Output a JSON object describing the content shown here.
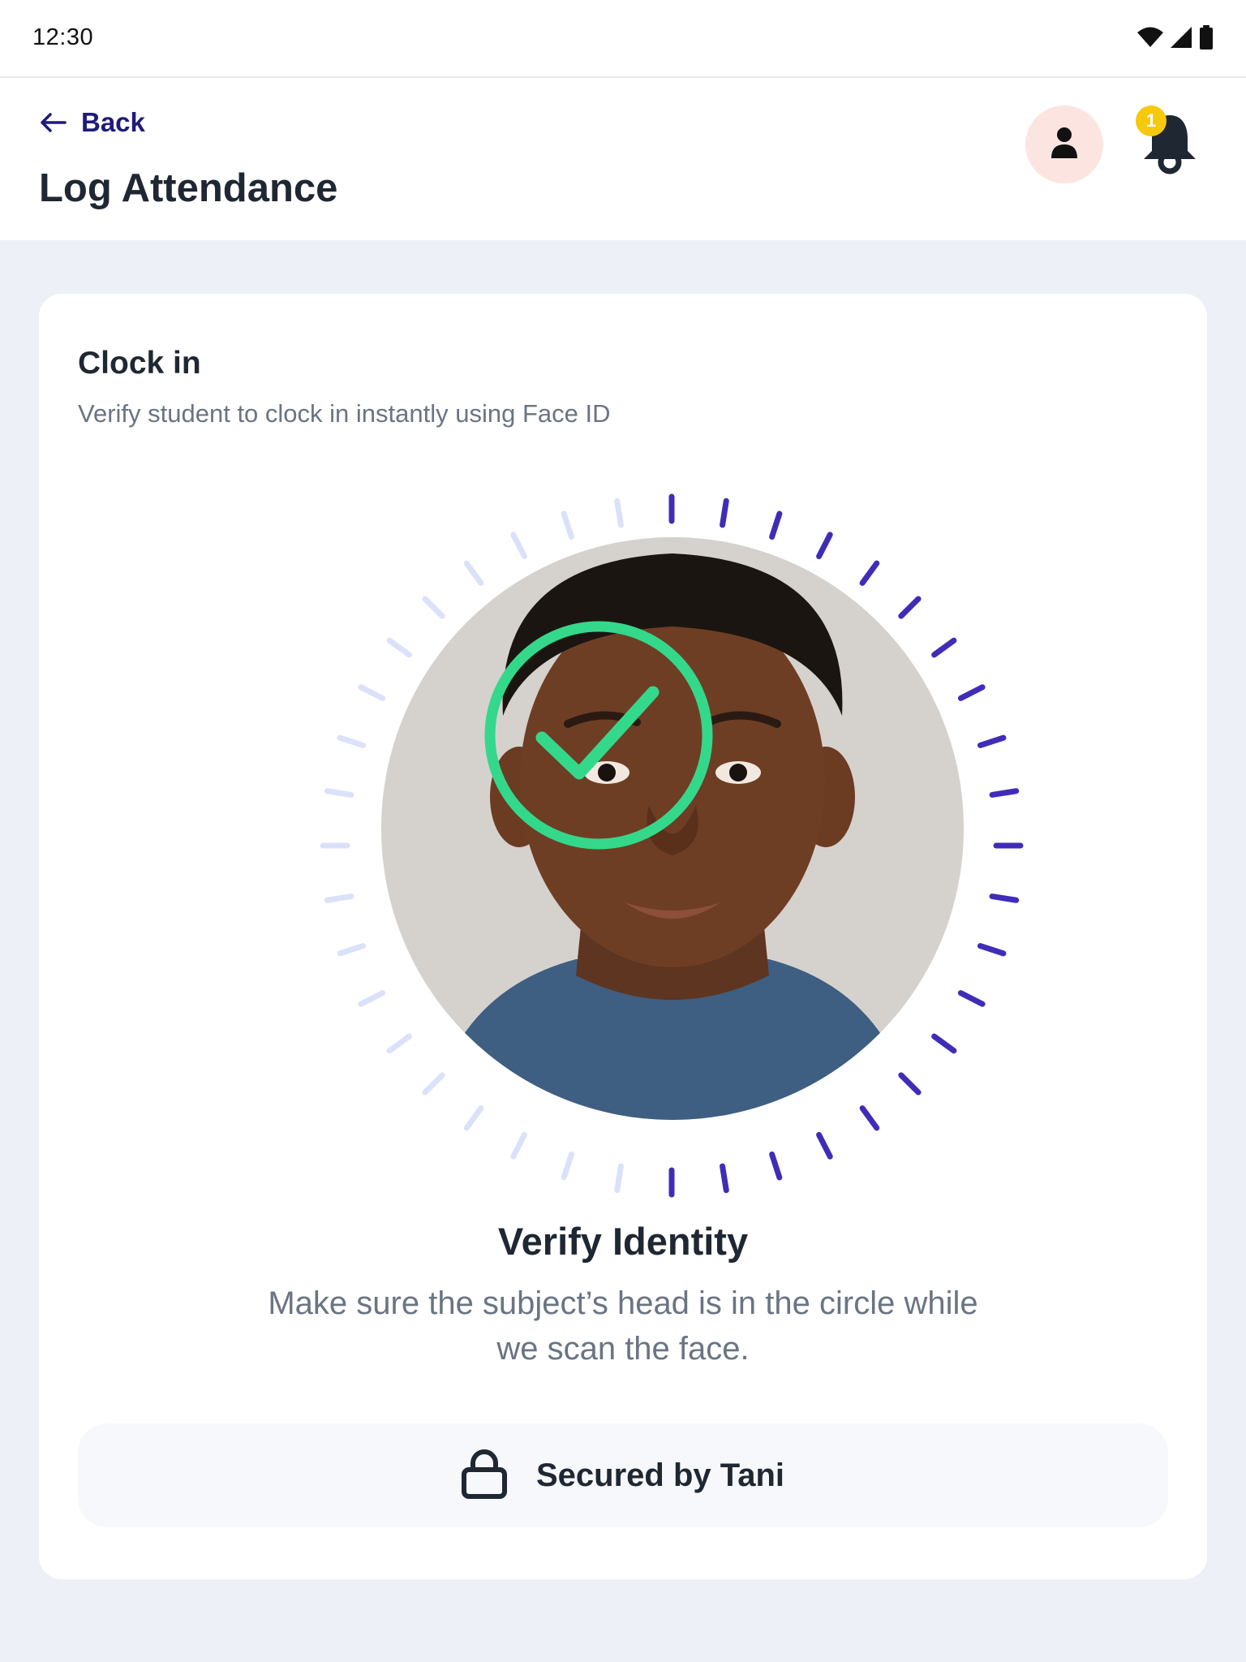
{
  "status_bar": {
    "time": "12:30",
    "icons": [
      "wifi-icon",
      "cellular-signal-icon",
      "battery-icon"
    ]
  },
  "header": {
    "back_label": "Back",
    "title": "Log Attendance",
    "notification_count": "1",
    "icons": [
      "arrow-left-icon",
      "user-icon",
      "bell-icon"
    ]
  },
  "clock_in": {
    "title": "Clock in",
    "subtitle": "Verify student to clock in instantly using Face ID",
    "progress": 0.5,
    "verify_title": "Verify Identity",
    "verify_text": "Make sure the subject’s head is in the circle while we scan the face.",
    "secured_label": "Secured by Tani",
    "icons": [
      "check-circle-icon",
      "lock-icon"
    ]
  },
  "colors": {
    "accent": "#3F2DB8",
    "accent_inactive": "#DCE1FA",
    "success": "#34D88A",
    "back_link": "#1E1B7A",
    "badge": "#F7C90C",
    "avatar_bg": "#FCE5E0",
    "page_bg": "#EDF0F7"
  }
}
